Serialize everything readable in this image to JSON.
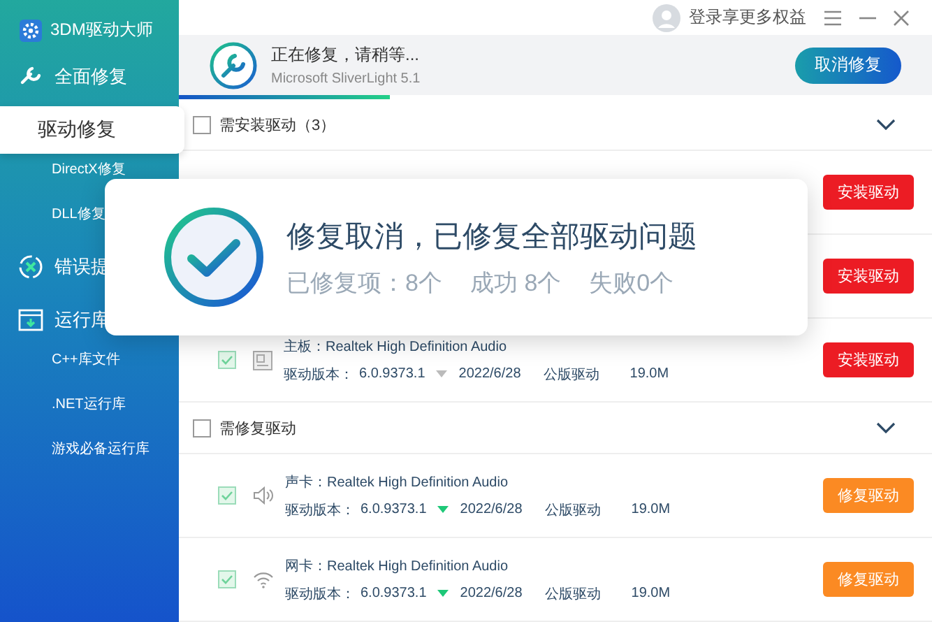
{
  "app": {
    "title": "3DM驱动大师"
  },
  "top_bar": {
    "login": "登录享更多权益"
  },
  "sidebar": {
    "items": [
      {
        "label": "全面修复",
        "selected": false
      },
      {
        "label": "驱动修复",
        "selected": true,
        "children": [
          {
            "label": "DirectX修复",
            "selected": false
          },
          {
            "label": "DLL修复",
            "selected": false
          }
        ]
      },
      {
        "label": "错误提",
        "selected": false
      },
      {
        "label": "运行库",
        "selected": false,
        "children": [
          {
            "label": "C++库文件",
            "selected": false
          },
          {
            "label": ".NET运行库",
            "selected": false
          },
          {
            "label": "游戏必备运行库",
            "selected": false
          }
        ]
      }
    ]
  },
  "status": {
    "title": "正在修复，请稍等...",
    "subtitle": "Microsoft SliverLight 5.1",
    "button": "取消修复",
    "level": 0.28
  },
  "sections": [
    {
      "kind": "install",
      "title": "需安装驱动（3）",
      "checked": false,
      "rows": [
        {
          "action": "安装驱动"
        },
        {
          "action": "安装驱动"
        },
        {
          "checked": true,
          "category": "主板：",
          "device": "Realtek High Definition Audio",
          "version_label": "驱动版本：",
          "version": "6.0.9373.1",
          "newer": false,
          "date": "2022/6/28",
          "type": "公版驱动",
          "size": "19.0M",
          "action": "安装驱动"
        }
      ]
    },
    {
      "kind": "repair",
      "title": "需修复驱动",
      "checked": false,
      "rows": [
        {
          "checked": true,
          "category": "声卡：",
          "device": "Realtek High Definition Audio",
          "version_label": "驱动版本：",
          "version": "6.0.9373.1",
          "newer": true,
          "date": "2022/6/28",
          "type": "公版驱动",
          "size": "19.0M",
          "action": "修复驱动"
        },
        {
          "checked": true,
          "category": "网卡：",
          "device": "Realtek High Definition Audio",
          "version_label": "驱动版本：",
          "version": "6.0.9373.1",
          "newer": true,
          "date": "2022/6/28",
          "type": "公版驱动",
          "size": "19.0M",
          "action": "修复驱动"
        }
      ]
    }
  ],
  "popup": {
    "title": "修复取消，已修复全部驱动问题",
    "stats": [
      "已修复项：8个",
      "成功 8个",
      "失败0个"
    ]
  }
}
